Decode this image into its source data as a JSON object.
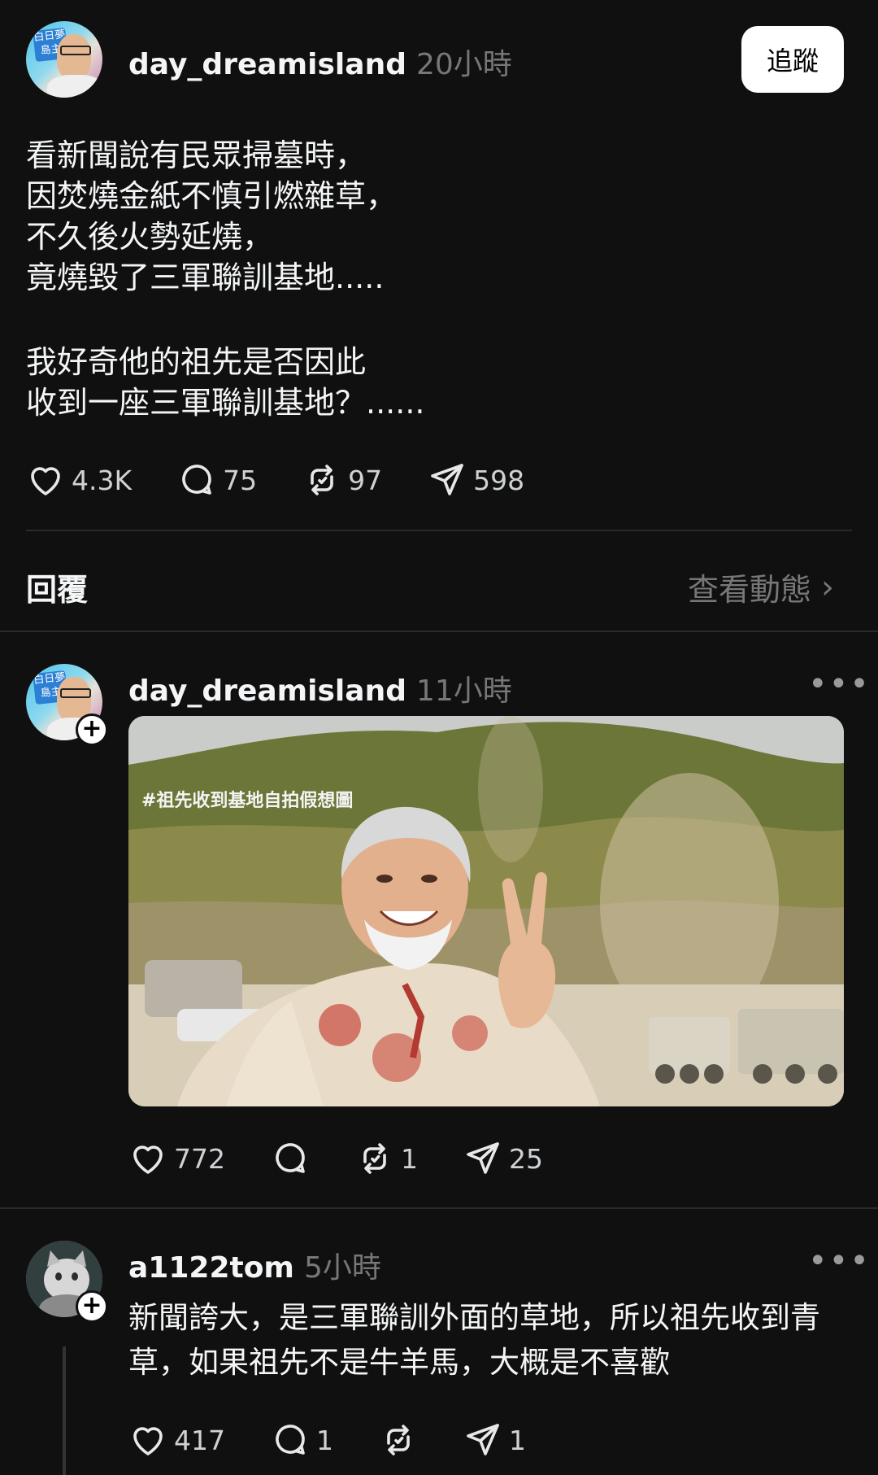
{
  "main_post": {
    "username": "day_dreamisland",
    "time": "20小時",
    "follow_label": "追蹤",
    "avatar_text": "白日夢\n島主",
    "paragraph1": "看新聞說有民眾掃墓時，\n因焚燒金紙不慎引燃雜草，\n不久後火勢延燒，\n竟燒毀了三軍聯訓基地.....",
    "paragraph2": "我好奇他的祖先是否因此\n收到一座三軍聯訓基地？......",
    "likes": "4.3K",
    "comments": "75",
    "reposts": "97",
    "shares": "598"
  },
  "replies_header": {
    "label": "回覆",
    "activity_label": "查看動態",
    "chevron": "›"
  },
  "reply1": {
    "username": "day_dreamisland",
    "time": "11小時",
    "more": "•••",
    "image_caption": "#祖先收到基地自拍假想圖",
    "likes": "772",
    "reposts": "1",
    "shares": "25"
  },
  "reply2": {
    "username": "a1122tom",
    "time": "5小時",
    "more": "•••",
    "text": "新聞誇大，是三軍聯訓外面的草地，所以祖先收到青草，如果祖先不是牛羊馬，大概是不喜歡",
    "likes": "417",
    "comments": "1",
    "shares": "1"
  },
  "icons": {
    "like": "heart-icon",
    "comment": "comment-bubble-icon",
    "repost": "repost-icon",
    "share": "send-icon",
    "more": "more-dots-icon",
    "follow_plus": "plus-icon"
  },
  "colors": {
    "background": "#101010",
    "text": "#f3f5f7",
    "muted": "#777777",
    "divider": "#2a2a2a"
  }
}
